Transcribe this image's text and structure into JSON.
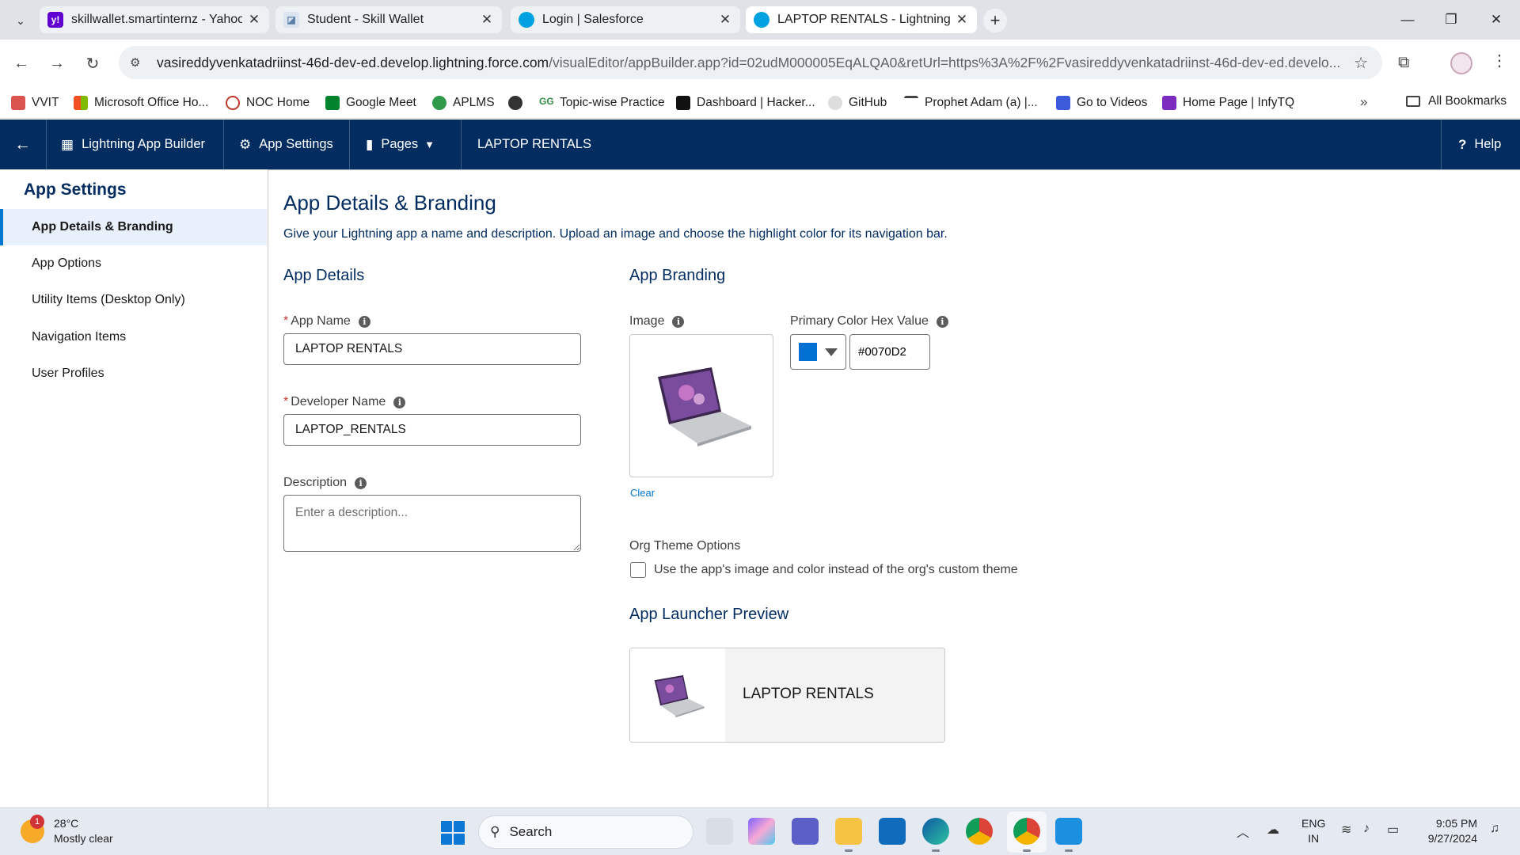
{
  "browser": {
    "tabs": [
      {
        "label": "skillwallet.smartinternz - Yahoo",
        "favicon_color": "#6001d2"
      },
      {
        "label": "Student - Skill Wallet",
        "favicon_color": "#5b7fa6"
      },
      {
        "label": "Login | Salesforce",
        "favicon_color": "#00a1e0"
      },
      {
        "label": "LAPTOP RENTALS - Lightning A",
        "favicon_color": "#00a1e0"
      }
    ],
    "url_host": "vasireddyvenkatadriinst-46d-dev-ed.develop.lightning.force.com",
    "url_rest": "/visualEditor/appBuilder.app?id=02udM000005EqALQA0&retUrl=https%3A%2F%2Fvasireddyvenkatadriinst-46d-dev-ed.develo...",
    "bookmarks": [
      {
        "label": "VVIT",
        "color": "#d9534f"
      },
      {
        "label": "Microsoft Office Ho...",
        "color": "#f25022"
      },
      {
        "label": "NOC Home",
        "color": "#c0392b"
      },
      {
        "label": "Google Meet",
        "color": "#00832d"
      },
      {
        "label": "APLMS",
        "color": "#2e9a4a"
      },
      {
        "label": "",
        "color": "#333333"
      },
      {
        "label": "Topic-wise Practice",
        "color": "#2f8d46"
      },
      {
        "label": "Dashboard | Hacker...",
        "color": "#111111"
      },
      {
        "label": "GitHub",
        "color": "#aaaaaa"
      },
      {
        "label": "Prophet Adam (a) |...",
        "color": "#444444"
      },
      {
        "label": "Go to Videos",
        "color": "#3b5bdb"
      },
      {
        "label": "Home Page | InfyTQ",
        "color": "#7b2cbf"
      }
    ],
    "all_bookmarks": "All Bookmarks"
  },
  "sf_header": {
    "builder": "Lightning App Builder",
    "settings": "App Settings",
    "pages": "Pages",
    "app_name": "LAPTOP RENTALS",
    "help": "Help"
  },
  "leftnav": {
    "title": "App Settings",
    "items": [
      "App Details & Branding",
      "App Options",
      "Utility Items (Desktop Only)",
      "Navigation Items",
      "User Profiles"
    ]
  },
  "main": {
    "title": "App Details & Branding",
    "description": "Give your Lightning app a name and description. Upload an image and choose the highlight color for its navigation bar.",
    "details_heading": "App Details",
    "app_name_label": "App Name",
    "app_name_value": "LAPTOP RENTALS",
    "dev_name_label": "Developer Name",
    "dev_name_value": "LAPTOP_RENTALS",
    "desc_label": "Description",
    "desc_placeholder": "Enter a description...",
    "branding_heading": "App Branding",
    "image_label": "Image",
    "clear_link": "Clear",
    "color_label": "Primary Color Hex Value",
    "color_value": "#0070D2",
    "theme_heading": "Org Theme Options",
    "theme_checkbox_label": "Use the app's image and color instead of the org's custom theme",
    "theme_checked": false,
    "preview_heading": "App Launcher Preview",
    "preview_name": "LAPTOP RENTALS"
  },
  "taskbar": {
    "temperature": "28°C",
    "weather": "Mostly clear",
    "weather_badge": "1",
    "search": "Search",
    "lang_1": "ENG",
    "lang_2": "IN",
    "time": "9:05 PM",
    "date": "9/27/2024"
  },
  "colors": {
    "header_bg": "#032d60",
    "brand_primary": "#0070D2",
    "active_nav": "#e8f1fb"
  }
}
